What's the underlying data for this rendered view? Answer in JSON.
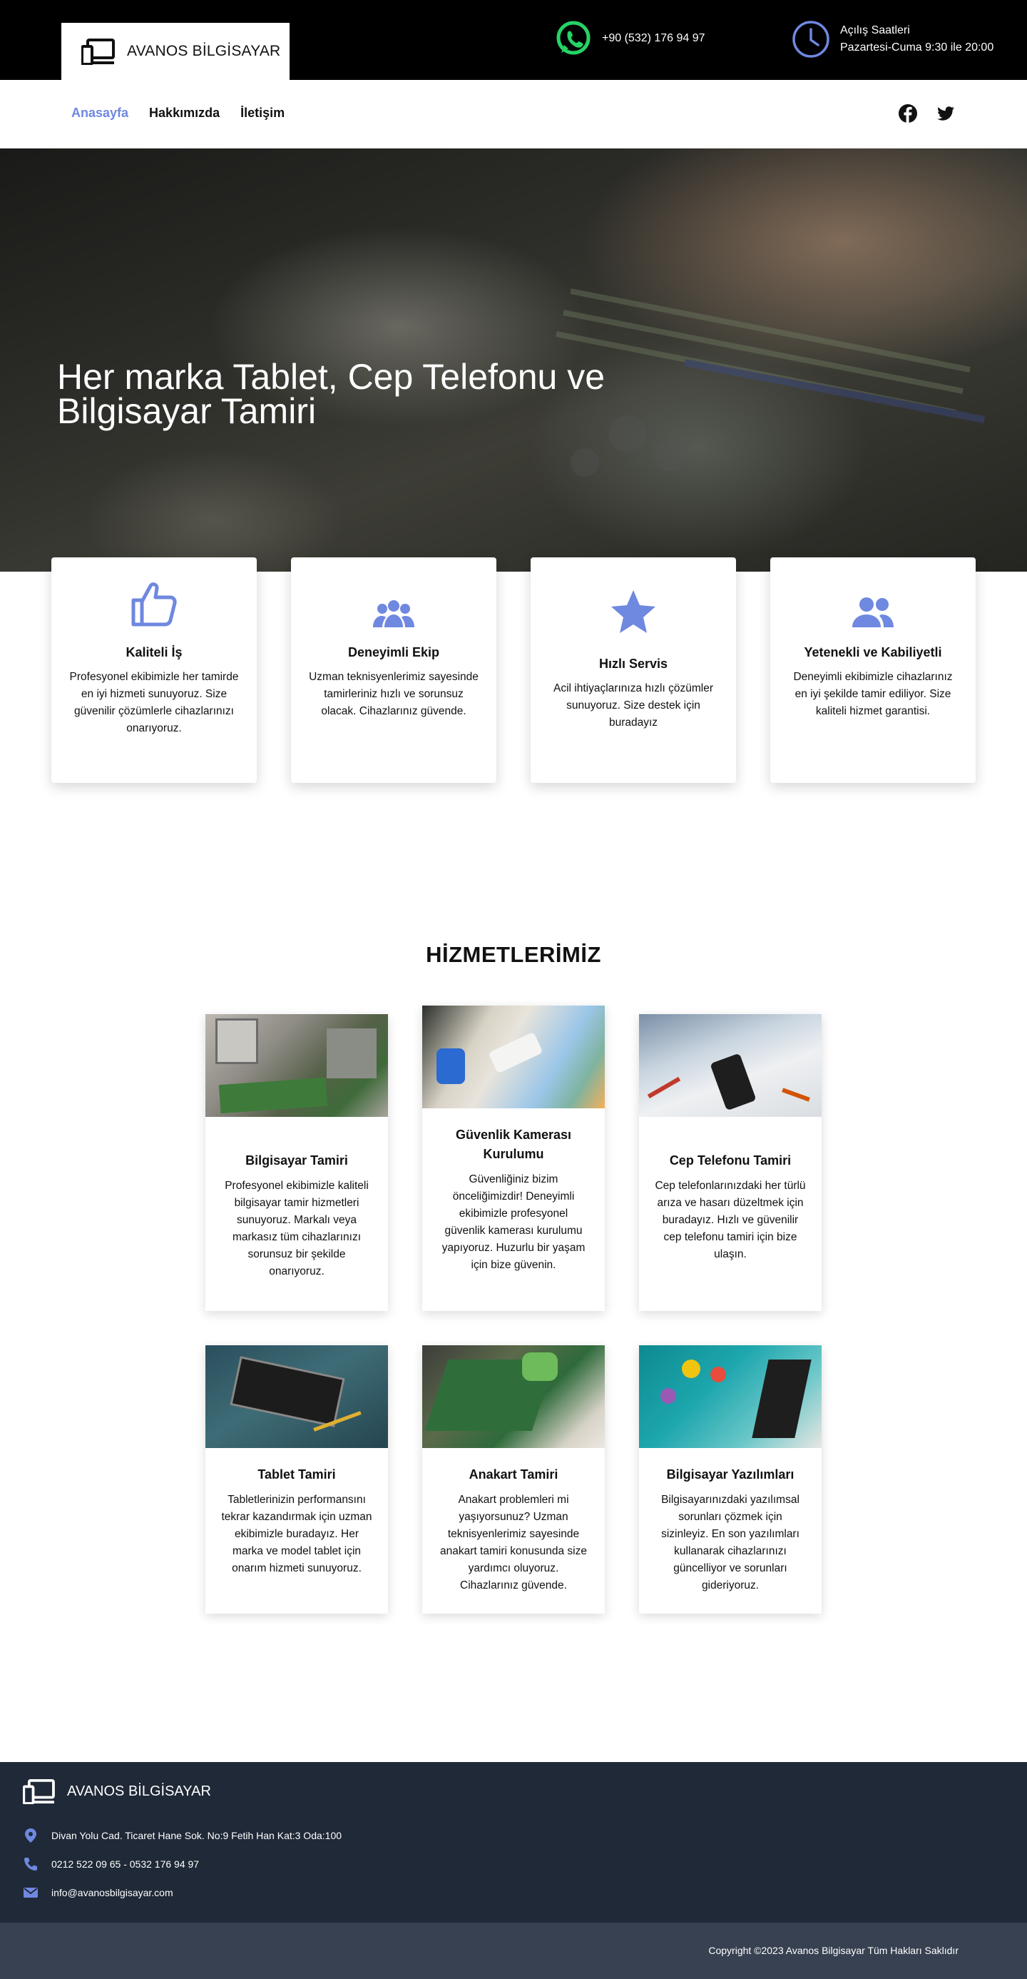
{
  "brand": {
    "name": "AVANOS BİLGİSAYAR",
    "accent": "#6f88e0",
    "whatsapp_green": "#25d366"
  },
  "header": {
    "phone": "+90 (532) 176 94 97",
    "hours_label": "Açılış Saatleri",
    "hours_value": "Pazartesi-Cuma 9:30 ile 20:00"
  },
  "nav": {
    "items": [
      {
        "label": "Anasayfa",
        "active": true
      },
      {
        "label": "Hakkımızda",
        "active": false
      },
      {
        "label": "İletişim",
        "active": false
      }
    ],
    "social": [
      "facebook-icon",
      "twitter-icon"
    ]
  },
  "hero": {
    "title": "Her marka Tablet, Cep Telefonu ve Bilgisayar Tamiri"
  },
  "features": [
    {
      "icon": "thumbs-up-icon",
      "title": "Kaliteli İş",
      "desc": "Profesyonel ekibimizle her tamirde en iyi hizmeti sunuyoruz. Size güvenilir çözümlerle cihazlarınızı onarıyoruz."
    },
    {
      "icon": "team-icon",
      "title": "Deneyimli Ekip",
      "desc": "Uzman teknisyenlerimiz sayesinde tamirleriniz hızlı ve sorunsuz olacak. Cihazlarınız güvende."
    },
    {
      "icon": "star-icon",
      "title": "Hızlı Servis",
      "desc": "Acil ihtiyaçlarınıza hızlı çözümler sunuyoruz. Size destek için buradayız"
    },
    {
      "icon": "people-icon",
      "title": "Yetenekli ve Kabiliyetli",
      "desc": "Deneyimli ekibimizle cihazlarınız en iyi şekilde tamir ediliyor. Size kaliteli hizmet garantisi."
    }
  ],
  "services": {
    "heading": "HİZMETLERİMİZ",
    "items": [
      {
        "title": "Bilgisayar Tamiri",
        "desc": "Profesyonel ekibimizle kaliteli bilgisayar tamir hizmetleri sunuyoruz. Markalı veya markasız tüm cihazlarınızı sorunsuz bir şekilde onarıyoruz."
      },
      {
        "title": "Güvenlik Kamerası Kurulumu",
        "desc": "Güvenliğiniz bizim önceliğimizdir! Deneyimli ekibimizle profesyonel güvenlik kamerası kurulumu yapıyoruz. Huzurlu bir yaşam için bize güvenin."
      },
      {
        "title": "Cep Telefonu Tamiri",
        "desc": "Cep telefonlarınızdaki her türlü arıza ve hasarı düzeltmek için buradayız. Hızlı ve güvenilir cep telefonu tamiri için bize ulaşın."
      },
      {
        "title": "Tablet Tamiri",
        "desc": "Tabletlerinizin performansını tekrar kazandırmak için uzman ekibimizle buradayız. Her marka ve model tablet için onarım hizmeti sunuyoruz."
      },
      {
        "title": "Anakart Tamiri",
        "desc": "Anakart problemleri mi yaşıyorsunuz? Uzman teknisyenlerimiz sayesinde anakart tamiri konusunda size yardımcı oluyoruz. Cihazlarınız güvende."
      },
      {
        "title": "Bilgisayar Yazılımları",
        "desc": "Bilgisayarınızdaki yazılımsal sorunları çözmek için sizinleyiz. En son yazılımları kullanarak cihazlarınızı güncelliyor ve sorunları gideriyoruz."
      }
    ]
  },
  "footer": {
    "brand": "AVANOS BİLGİSAYAR",
    "address": "Divan Yolu Cad. Ticaret Hane Sok. No:9 Fetih Han Kat:3 Oda:100",
    "phones": "0212 522 09 65 - 0532 176 94 97",
    "email": "info@avanosbilgisayar.com",
    "copyright": "Copyright ©2023 Avanos Bilgisayar Tüm Hakları Saklıdır"
  }
}
